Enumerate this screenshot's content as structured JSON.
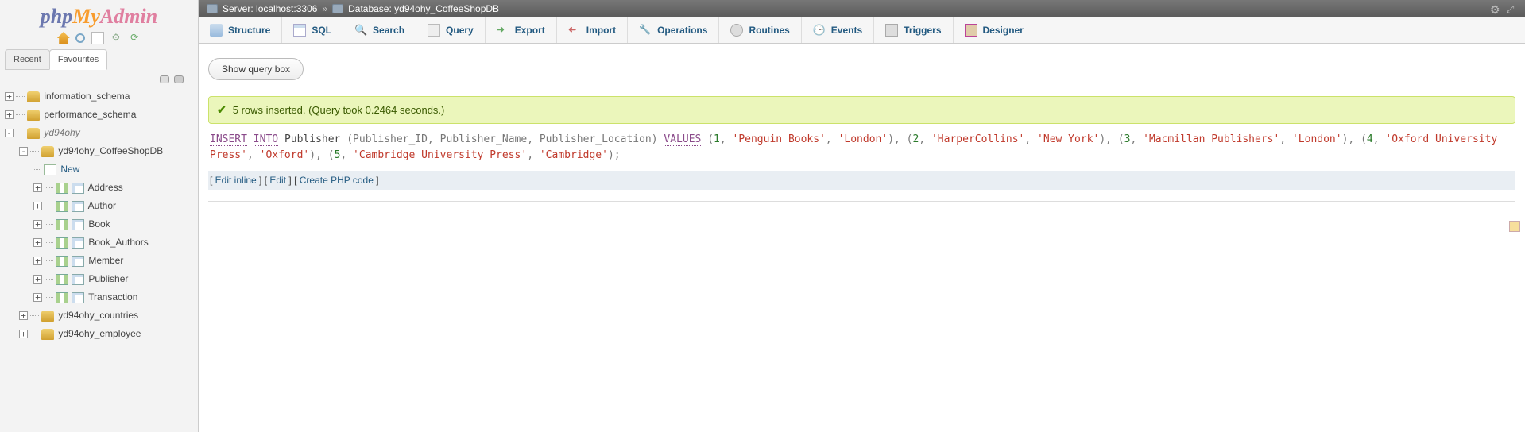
{
  "logo": {
    "p1": "php",
    "p2": "My",
    "p3": "Admin"
  },
  "sidebar_tabs": {
    "recent": "Recent",
    "fav": "Favourites"
  },
  "tree": {
    "dbs": [
      {
        "name": "information_schema",
        "type": "db",
        "expanded": false
      },
      {
        "name": "performance_schema",
        "type": "db",
        "expanded": false
      }
    ],
    "user_db": {
      "name": "yd94ohy",
      "children": [
        {
          "name": "yd94ohy_CoffeeShopDB",
          "expanded": true,
          "items": [
            {
              "name": "New",
              "new": true
            },
            {
              "name": "Address"
            },
            {
              "name": "Author"
            },
            {
              "name": "Book"
            },
            {
              "name": "Book_Authors"
            },
            {
              "name": "Member"
            },
            {
              "name": "Publisher"
            },
            {
              "name": "Transaction"
            }
          ]
        },
        {
          "name": "yd94ohy_countries",
          "expanded": false
        },
        {
          "name": "yd94ohy_employee",
          "expanded": false
        }
      ]
    }
  },
  "breadcrumb": {
    "server_label": "Server:",
    "server": "localhost:3306",
    "db_label": "Database:",
    "db": "yd94ohy_CoffeeShopDB"
  },
  "menu": [
    {
      "k": "struct",
      "label": "Structure"
    },
    {
      "k": "sql",
      "label": "SQL"
    },
    {
      "k": "search",
      "label": "Search"
    },
    {
      "k": "query",
      "label": "Query"
    },
    {
      "k": "export",
      "label": "Export"
    },
    {
      "k": "import",
      "label": "Import"
    },
    {
      "k": "ops",
      "label": "Operations"
    },
    {
      "k": "rout",
      "label": "Routines"
    },
    {
      "k": "evt",
      "label": "Events"
    },
    {
      "k": "trig",
      "label": "Triggers"
    },
    {
      "k": "des",
      "label": "Designer"
    }
  ],
  "buttons": {
    "show_query": "Show query box"
  },
  "notice": "5 rows inserted. (Query took 0.2464 seconds.)",
  "sql": {
    "kw_insert": "INSERT",
    "kw_into": "INTO",
    "tbl": "Publisher",
    "cols": "(Publisher_ID, Publisher_Name, Publisher_Location)",
    "kw_values": "VALUES",
    "rows": [
      {
        "n": "1",
        "a": "'Penguin Books'",
        "b": "'London'"
      },
      {
        "n": "2",
        "a": "'HarperCollins'",
        "b": "'New York'"
      },
      {
        "n": "3",
        "a": "'Macmillan Publishers'",
        "b": "'London'"
      },
      {
        "n": "4",
        "a": "'Oxford University Press'",
        "b": "'Oxford'"
      },
      {
        "n": "5",
        "a": "'Cambridge University Press'",
        "b": "'Cambridge'"
      }
    ]
  },
  "links": {
    "edit_inline": "Edit inline",
    "edit": "Edit",
    "create_php": "Create PHP code"
  }
}
